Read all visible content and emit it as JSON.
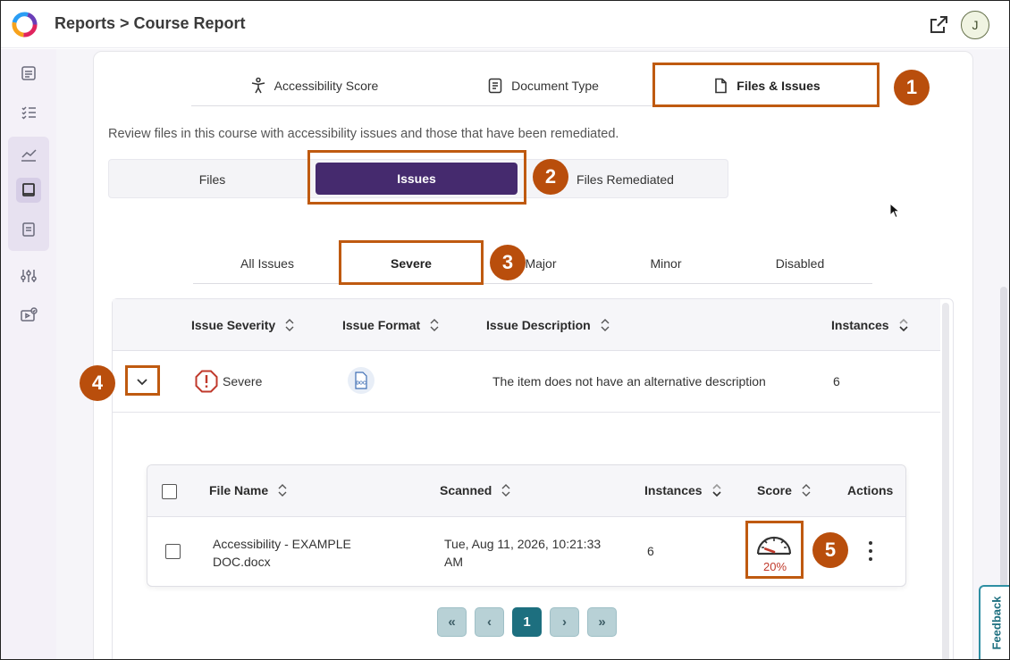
{
  "header": {
    "title": "Reports > Course Report",
    "avatar_initial": "J",
    "open_new_icon": "external-link-icon",
    "logo_icon": "app-logo-icon"
  },
  "sidebar": {
    "items": [
      {
        "icon": "document-icon"
      },
      {
        "icon": "checklist-icon"
      },
      {
        "icon": "chart-icon"
      },
      {
        "icon": "book-icon"
      },
      {
        "icon": "note-icon"
      },
      {
        "icon": "sliders-icon"
      },
      {
        "icon": "video-check-icon"
      }
    ]
  },
  "main_tabs": [
    {
      "label": "Accessibility Score",
      "icon": "accessibility-icon"
    },
    {
      "label": "Document Type",
      "icon": "document-type-icon"
    },
    {
      "label": "Files & Issues",
      "icon": "file-icon",
      "active": true
    }
  ],
  "description": "Review files in this course with accessibility issues and those that have been remediated.",
  "view_toggle": [
    {
      "label": "Files"
    },
    {
      "label": "Issues",
      "active": true
    },
    {
      "label": "Files Remediated"
    }
  ],
  "severity_tabs": [
    {
      "label": "All Issues"
    },
    {
      "label": "Severe",
      "active": true
    },
    {
      "label": "Major"
    },
    {
      "label": "Minor"
    },
    {
      "label": "Disabled"
    }
  ],
  "issues_table": {
    "columns": [
      "Issue Severity",
      "Issue Format",
      "Issue Description",
      "Instances"
    ],
    "rows": [
      {
        "severity": "Severe",
        "format_icon": "doc-format-icon",
        "format_label": "DOC",
        "description": "The item does not have an alternative description",
        "instances": "6"
      }
    ]
  },
  "files_table": {
    "columns": [
      "File Name",
      "Scanned",
      "Instances",
      "Score",
      "Actions"
    ],
    "rows": [
      {
        "file_name_line1": "Accessibility - EXAMPLE",
        "file_name_line2": "DOC.docx",
        "scanned_line1": "Tue, Aug 11, 2026, 10:21:33",
        "scanned_line2": "AM",
        "instances": "6",
        "score": "20%",
        "score_value": 20
      }
    ]
  },
  "pagination": {
    "first": "«",
    "prev": "‹",
    "current": "1",
    "next": "›",
    "last": "»"
  },
  "annotations": [
    "1",
    "2",
    "3",
    "4",
    "5"
  ],
  "feedback_label": "Feedback",
  "colors": {
    "accent_purple": "#452a6e",
    "annotation_orange": "#bf5a10",
    "severe_red": "#c0392b",
    "pagination_teal": "#1d6f7f"
  }
}
